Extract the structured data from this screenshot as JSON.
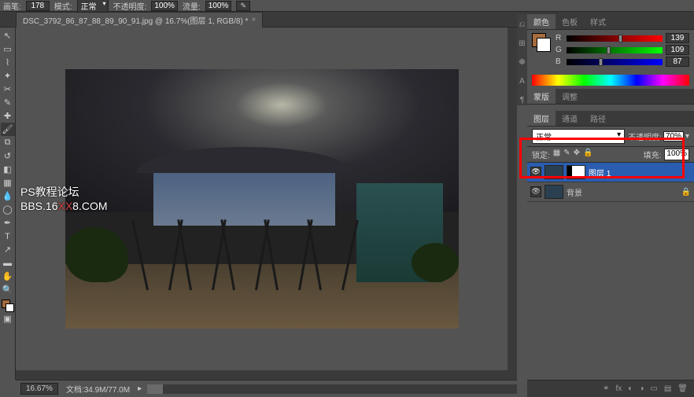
{
  "options": {
    "brush_label": "画笔:",
    "brush_size": "178",
    "mode_label": "模式:",
    "mode_value": "正常",
    "opacity_label": "不透明度:",
    "opacity_value": "100%",
    "flow_label": "流量:",
    "flow_value": "100%"
  },
  "tab": {
    "title": "DSC_3792_86_87_88_89_90_91.jpg @ 16.7%(图层 1, RGB/8) *",
    "close": "×"
  },
  "watermark": {
    "line1": "PS教程论坛",
    "line2a": "BBS.16",
    "line2b": "XX",
    "line2c": "8.COM"
  },
  "status": {
    "zoom": "16.67%",
    "doc": "文档:34.9M/77.0M"
  },
  "color_panel": {
    "tabs": [
      "颜色",
      "色板",
      "样式"
    ],
    "r_label": "R",
    "r_value": "139",
    "g_label": "G",
    "g_value": "109",
    "b_label": "B",
    "b_value": "87"
  },
  "adjust_panel": {
    "tabs": [
      "蒙版",
      "调整"
    ]
  },
  "layers_panel": {
    "tabs": [
      "图层",
      "通道",
      "路径"
    ],
    "blend_mode": "正常",
    "opacity_label": "不透明度:",
    "opacity_value": "70%",
    "lock_label": "锁定:",
    "fill_label": "填充:",
    "fill_value": "100%",
    "layer1": "图层 1",
    "background": "背景"
  }
}
